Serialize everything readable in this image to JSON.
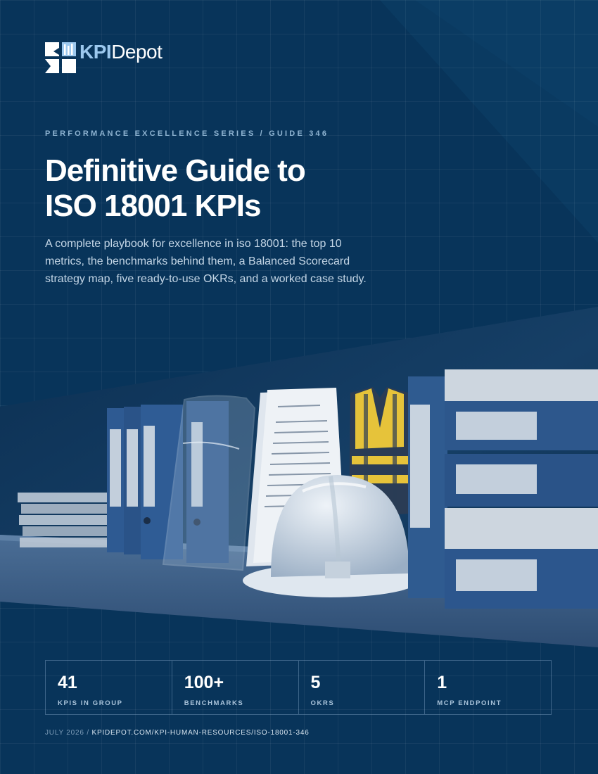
{
  "brand": {
    "name_part1": "KPI",
    "name_part2": "Depot"
  },
  "series_line": "PERFORMANCE EXCELLENCE SERIES / GUIDE 346",
  "title_lines": [
    "Definitive Guide to",
    "ISO 18001 KPIs"
  ],
  "subtitle": "A complete playbook for excellence in iso 18001: the top 10 metrics, the benchmarks behind them, a Balanced Scorecard strategy map, five ready-to-use OKRs, and a worked case study.",
  "stats": [
    {
      "value": "41",
      "label": "KPIS IN GROUP"
    },
    {
      "value": "100+",
      "label": "BENCHMARKS"
    },
    {
      "value": "5",
      "label": "OKRS"
    },
    {
      "value": "1",
      "label": "MCP ENDPOINT"
    }
  ],
  "footer": {
    "date": "JULY 2026",
    "separator": " / ",
    "url": "KPIDEPOT.COM/KPI-HUMAN-RESOURCES/ISO-18001-346"
  },
  "colors": {
    "background": "#08345a",
    "accent": "#9cc8ee",
    "text": "#ffffff"
  },
  "icons": {
    "logo": "kpidepot-logo-icon"
  }
}
